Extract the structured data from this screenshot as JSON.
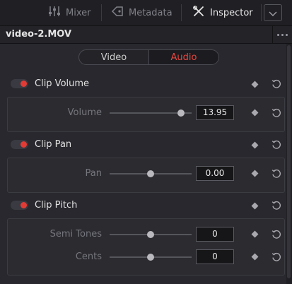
{
  "tabs": {
    "mixer": "Mixer",
    "metadata": "Metadata",
    "inspector": "Inspector"
  },
  "panel": {
    "title": "video-2.MOV"
  },
  "segment": {
    "video": "Video",
    "audio": "Audio",
    "selected": "Audio"
  },
  "sections": {
    "volume": {
      "header": "Clip Volume",
      "enabled": true,
      "param_label": "Volume",
      "value": "13.95",
      "slider_level": 0.87
    },
    "pan": {
      "header": "Clip Pan",
      "enabled": true,
      "param_label": "Pan",
      "value": "0.00",
      "slider_level": 0.5
    },
    "pitch": {
      "header": "Clip Pitch",
      "enabled": true,
      "semitones_label": "Semi Tones",
      "semitones_value": "0",
      "semitones_level": 0.5,
      "cents_label": "Cents",
      "cents_value": "0",
      "cents_level": 0.5
    }
  },
  "colors": {
    "accent": "#e8473f",
    "background": "#28282e"
  }
}
